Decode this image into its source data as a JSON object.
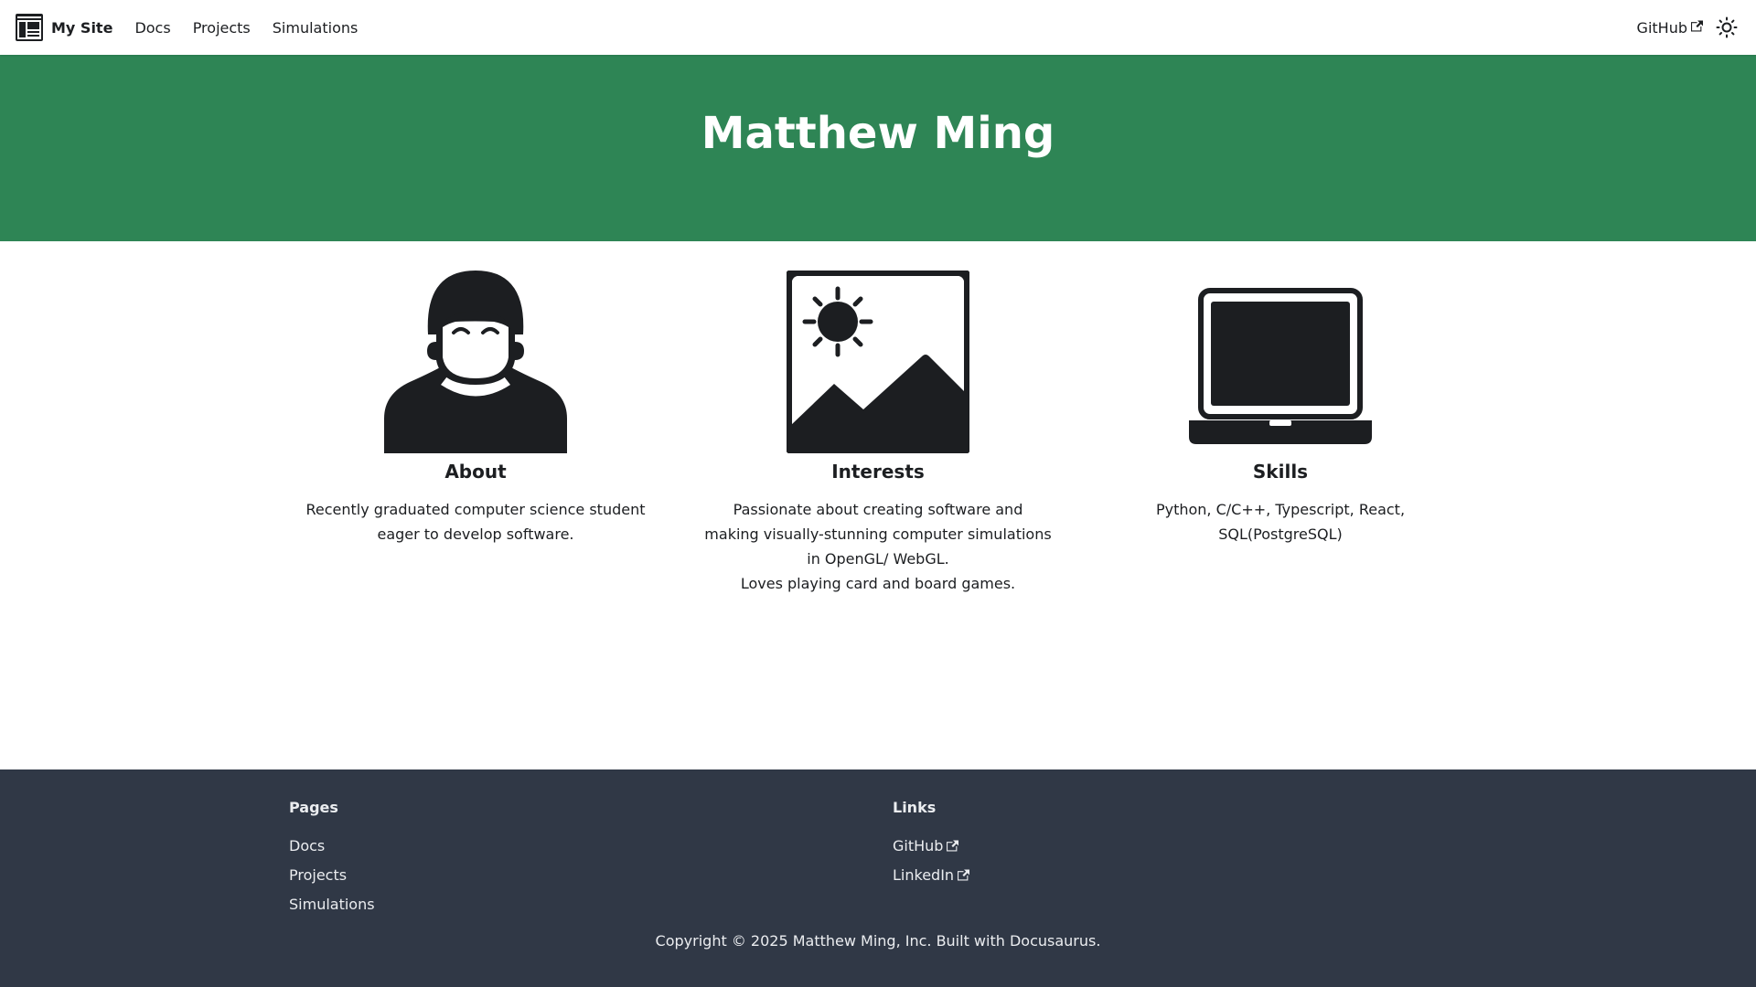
{
  "navbar": {
    "brand_title": "My Site",
    "links": [
      "Docs",
      "Projects",
      "Simulations"
    ],
    "github_label": "GitHub",
    "logo_icon": "site-logo-icon",
    "theme_icon": "sun-icon"
  },
  "hero": {
    "title": "Matthew Ming",
    "background": "#2e8555"
  },
  "features": [
    {
      "icon": "person-icon",
      "title": "About",
      "description": "Recently graduated computer science student eager to develop software."
    },
    {
      "icon": "image-icon",
      "title": "Interests",
      "description": "Passionate about creating software and making visually-stunning computer simulations in OpenGL/ WebGL.\nLoves playing card and board games."
    },
    {
      "icon": "laptop-icon",
      "title": "Skills",
      "description": "Python, C/C++, Typescript, React, SQL(PostgreSQL)"
    }
  ],
  "footer": {
    "pages_title": "Pages",
    "pages": [
      "Docs",
      "Projects",
      "Simulations"
    ],
    "links_title": "Links",
    "links": [
      "GitHub",
      "LinkedIn"
    ],
    "copyright": "Copyright © 2025 Matthew Ming, Inc. Built with Docusaurus.",
    "background": "#303846"
  }
}
